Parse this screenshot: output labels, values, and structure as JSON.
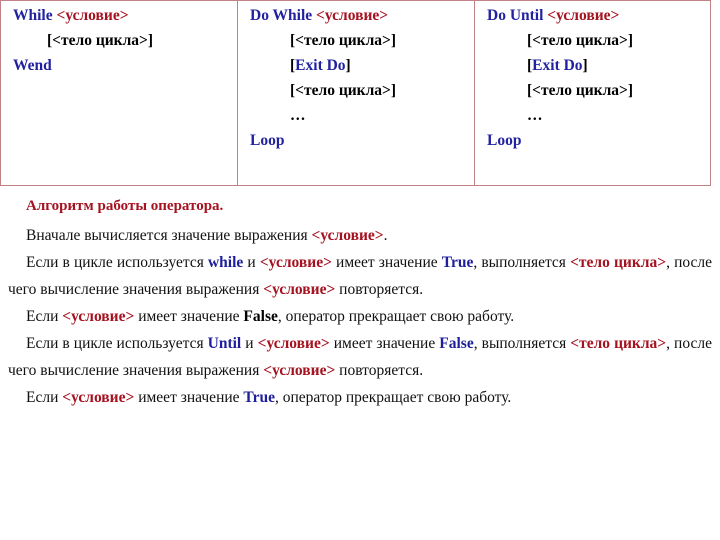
{
  "document": {
    "type": "lecture-slide",
    "language": "ru",
    "background_color": "#ffffff",
    "colors": {
      "keyword_blue": "#2222a0",
      "condition_red": "#a51220",
      "heading_red": "#a51220",
      "table_border": "#c08287",
      "body_text": "#111111"
    }
  },
  "syntax_table": {
    "columns": [
      {
        "name": "while-wend",
        "lines": [
          {
            "indent": 0,
            "parts": [
              {
                "text": "While ",
                "style": "kw"
              },
              {
                "text": "<условие>",
                "style": "cond"
              }
            ]
          },
          {
            "indent": 1,
            "parts": [
              {
                "text": "[",
                "style": "brk"
              },
              {
                "text": "<тело цикла>",
                "style": "blk"
              },
              {
                "text": "]",
                "style": "brk"
              }
            ]
          },
          {
            "indent": 0,
            "parts": [
              {
                "text": "Wend",
                "style": "kw"
              }
            ]
          }
        ]
      },
      {
        "name": "do-while-loop",
        "lines": [
          {
            "indent": 0,
            "parts": [
              {
                "text": "Do While ",
                "style": "kw"
              },
              {
                "text": "<условие>",
                "style": "cond"
              }
            ]
          },
          {
            "indent": 1,
            "parts": [
              {
                "text": "[",
                "style": "brk"
              },
              {
                "text": "<тело цикла>",
                "style": "blk"
              },
              {
                "text": "]",
                "style": "brk"
              }
            ]
          },
          {
            "indent": 1,
            "parts": [
              {
                "text": "[",
                "style": "brk"
              },
              {
                "text": "Exit Do",
                "style": "kw"
              },
              {
                "text": "]",
                "style": "brk"
              }
            ]
          },
          {
            "indent": 1,
            "parts": [
              {
                "text": "[",
                "style": "brk"
              },
              {
                "text": "<тело цикла>",
                "style": "blk"
              },
              {
                "text": "]",
                "style": "brk"
              }
            ]
          },
          {
            "indent": 1,
            "parts": [
              {
                "text": "…",
                "style": "blk"
              }
            ]
          },
          {
            "indent": 0,
            "parts": [
              {
                "text": "Loop",
                "style": "kw"
              }
            ]
          }
        ]
      },
      {
        "name": "do-until-loop",
        "lines": [
          {
            "indent": 0,
            "parts": [
              {
                "text": "Do  Until ",
                "style": "kw"
              },
              {
                "text": "<условие>",
                "style": "cond"
              }
            ]
          },
          {
            "indent": 1,
            "parts": [
              {
                "text": "[",
                "style": "brk"
              },
              {
                "text": "<тело цикла>",
                "style": "blk"
              },
              {
                "text": "]",
                "style": "brk"
              }
            ]
          },
          {
            "indent": 1,
            "parts": [
              {
                "text": "[",
                "style": "brk"
              },
              {
                "text": "Exit Do",
                "style": "kw"
              },
              {
                "text": "]",
                "style": "brk"
              }
            ]
          },
          {
            "indent": 1,
            "parts": [
              {
                "text": "[",
                "style": "brk"
              },
              {
                "text": "<тело цикла>",
                "style": "blk"
              },
              {
                "text": "]",
                "style": "brk"
              }
            ]
          },
          {
            "indent": 1,
            "parts": [
              {
                "text": "…",
                "style": "blk"
              }
            ]
          },
          {
            "indent": 0,
            "parts": [
              {
                "text": "Loop",
                "style": "kw"
              }
            ]
          }
        ]
      }
    ]
  },
  "body": {
    "heading": "Алгоритм работы оператора.",
    "paragraphs": [
      {
        "name": "intro",
        "segments": [
          {
            "text": "Вначале вычисляется значение выражения ",
            "style": "plain"
          },
          {
            "text": "<условие>",
            "style": "red"
          },
          {
            "text": ".",
            "style": "plain"
          }
        ]
      },
      {
        "name": "while-true-branch",
        "segments": [
          {
            "text": "Если в цикле используется ",
            "style": "plain"
          },
          {
            "text": "while",
            "style": "blue"
          },
          {
            "text": " и ",
            "style": "plain"
          },
          {
            "text": "<условие>",
            "style": "red"
          },
          {
            "text": " имеет значение ",
            "style": "plain"
          },
          {
            "text": "True",
            "style": "blue"
          },
          {
            "text": ", выполняется ",
            "style": "plain"
          },
          {
            "text": "<тело цикла>",
            "style": "red"
          },
          {
            "text": ", после чего вычисление значения выражения ",
            "style": "plain"
          },
          {
            "text": "<условие>",
            "style": "red"
          },
          {
            "text": " повторяется.",
            "style": "plain"
          }
        ]
      },
      {
        "name": "while-false-branch",
        "segments": [
          {
            "text": "Если ",
            "style": "plain"
          },
          {
            "text": "<условие>",
            "style": "red"
          },
          {
            "text": " имеет значение ",
            "style": "plain"
          },
          {
            "text": "False",
            "style": "black-bold"
          },
          {
            "text": ", оператор прекращает свою работу.",
            "style": "plain"
          }
        ]
      },
      {
        "name": "until-false-branch",
        "segments": [
          {
            "text": "Если в цикле используется ",
            "style": "plain"
          },
          {
            "text": "Until",
            "style": "blue"
          },
          {
            "text": " и ",
            "style": "plain"
          },
          {
            "text": "<условие>",
            "style": "red"
          },
          {
            "text": " имеет значение ",
            "style": "plain"
          },
          {
            "text": "False",
            "style": "blue"
          },
          {
            "text": ", выполняется ",
            "style": "plain"
          },
          {
            "text": "<тело цикла>",
            "style": "red"
          },
          {
            "text": ", после чего вычисление значения выражения ",
            "style": "plain"
          },
          {
            "text": "<условие>",
            "style": "red"
          },
          {
            "text": " повторяется.",
            "style": "plain"
          }
        ]
      },
      {
        "name": "until-true-branch",
        "segments": [
          {
            "text": "Если ",
            "style": "plain"
          },
          {
            "text": "<условие>",
            "style": "red"
          },
          {
            "text": " имеет значение ",
            "style": "plain"
          },
          {
            "text": "True",
            "style": "blue"
          },
          {
            "text": ", оператор прекращает свою работу.",
            "style": "plain"
          }
        ]
      }
    ]
  }
}
